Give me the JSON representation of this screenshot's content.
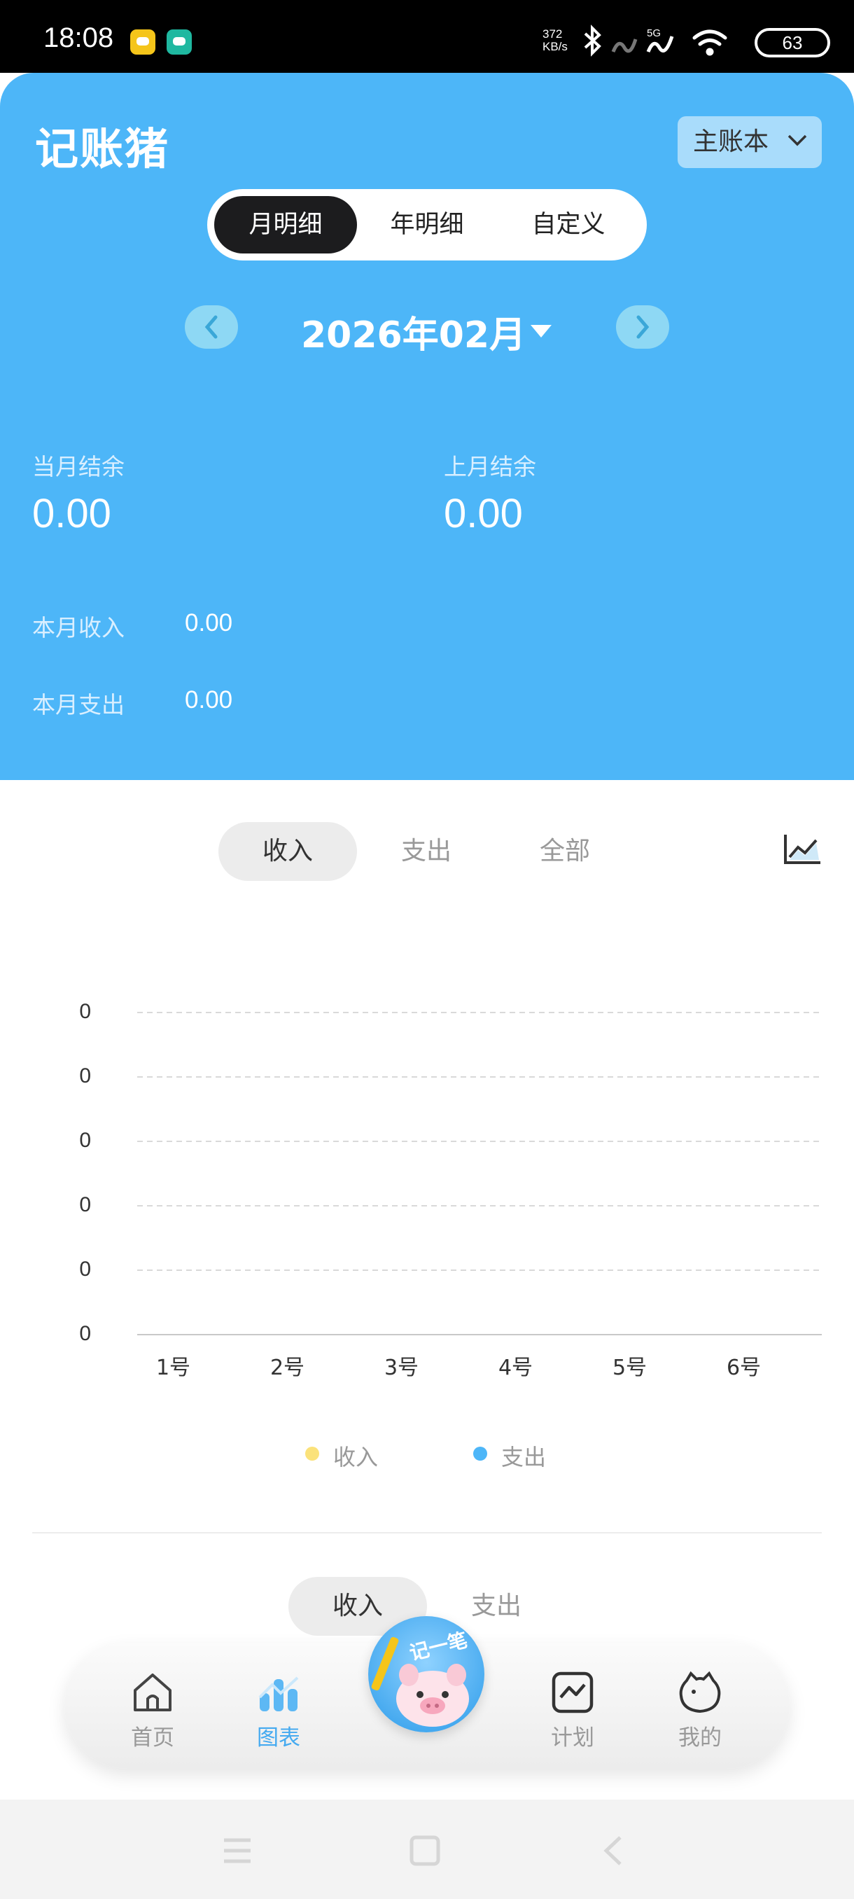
{
  "status_bar": {
    "time": "18:08",
    "net_speed_value": "372",
    "net_speed_unit": "KB/s",
    "signal_label": "5G",
    "battery": "63"
  },
  "header": {
    "app_title": "记账猪",
    "book_selector": "主账本",
    "period_tabs": [
      "月明细",
      "年明细",
      "自定义"
    ],
    "active_period_tab": 0,
    "month": "2026年02月"
  },
  "summary": {
    "current_balance_label": "当月结余",
    "current_balance": "0.00",
    "last_balance_label": "上月结余",
    "last_balance": "0.00",
    "income_label": "本月收入",
    "income": "0.00",
    "expense_label": "本月支出",
    "expense": "0.00"
  },
  "type_tabs": [
    "收入",
    "支出",
    "全部"
  ],
  "active_type_tab": 0,
  "chart_data": {
    "type": "line",
    "categories": [
      "1号",
      "2号",
      "3号",
      "4号",
      "5号",
      "6号"
    ],
    "y_tick_labels": [
      "0",
      "0",
      "0",
      "0",
      "0",
      "0"
    ],
    "series": [
      {
        "name": "收入",
        "color": "#fbe27a",
        "values": [
          0,
          0,
          0,
          0,
          0,
          0
        ]
      },
      {
        "name": "支出",
        "color": "#4db6f8",
        "values": [
          0,
          0,
          0,
          0,
          0,
          0
        ]
      }
    ],
    "grid": true,
    "legend_position": "bottom"
  },
  "sub_tabs": [
    "收入",
    "支出"
  ],
  "active_sub_tab": 0,
  "bottom_nav": {
    "items": [
      "首页",
      "图表",
      "计划",
      "我的"
    ],
    "active": 1,
    "fab_label": "记一笔"
  },
  "colors": {
    "primary": "#4db6f8",
    "active_tab_bg": "#1c1c1e"
  }
}
